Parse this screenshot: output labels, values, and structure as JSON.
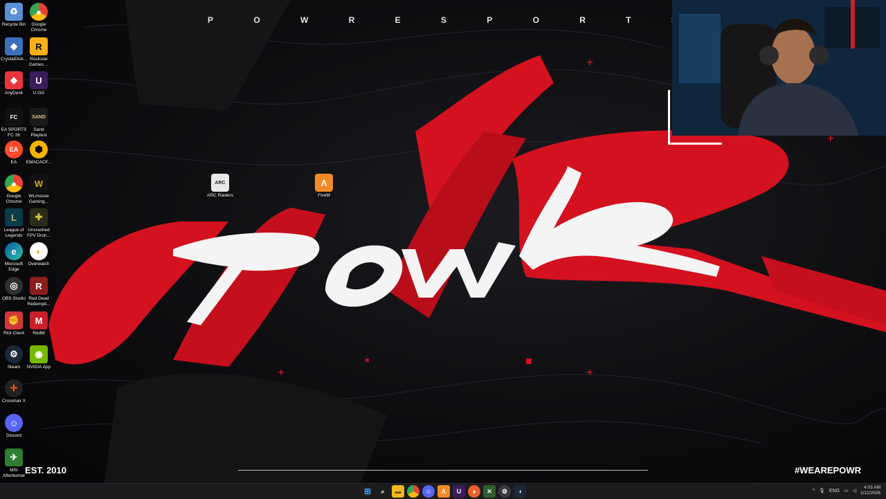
{
  "wallpaper": {
    "wordmark_letters": [
      "P",
      "O",
      "W",
      "R",
      "E",
      "S",
      "P",
      "O",
      "R",
      "T",
      "S"
    ],
    "est": "EST. 2010",
    "hashtag": "#WEAREPOWR",
    "logo_text": "POWR",
    "colors": {
      "red": "#d4111f",
      "white": "#f4f4f4",
      "dark": "#0b0b0d"
    }
  },
  "desktop_icons": [
    {
      "label": "Recycle Bin",
      "icon": "recycle-bin-icon"
    },
    {
      "label": "Google Chrome",
      "icon": "chrome-icon"
    },
    {
      "label": "CrystalDisk...",
      "icon": "crystaldisk-icon"
    },
    {
      "label": "Rockstar Games ...",
      "icon": "rockstar-icon"
    },
    {
      "label": "AnyDesk",
      "icon": "anydesk-icon"
    },
    {
      "label": "U.GG",
      "icon": "ugg-icon"
    },
    {
      "label": "EA SPORTS FC 26",
      "icon": "ea-fc-icon"
    },
    {
      "label": "Sand Playtest",
      "icon": "sand-icon"
    },
    {
      "label": "EA",
      "icon": "ea-icon"
    },
    {
      "label": "EMACACF...",
      "icon": "emacacf-icon"
    },
    {
      "label": "Google Chrome",
      "icon": "chrome-icon"
    },
    {
      "label": "WLmouse Gaming...",
      "icon": "wlmouse-icon"
    },
    {
      "label": "League of Legends",
      "icon": "league-icon"
    },
    {
      "label": "Uncrashed FPV Dron...",
      "icon": "uncrashed-icon"
    },
    {
      "label": "Microsoft Edge",
      "icon": "edge-icon"
    },
    {
      "label": "Overwatch",
      "icon": "overwatch-icon"
    },
    {
      "label": "OBS Studio",
      "icon": "obs-icon"
    },
    {
      "label": "Red Dead Redempti...",
      "icon": "rdr-icon"
    },
    {
      "label": "Riot Client",
      "icon": "riot-icon"
    },
    {
      "label": "RedM",
      "icon": "redm-icon"
    },
    {
      "label": "Steam",
      "icon": "steam-icon"
    },
    {
      "label": "NVIDIA App",
      "icon": "nvidia-icon"
    },
    {
      "label": "Crosshair X",
      "icon": "crosshair-icon"
    },
    {
      "label": "Discord",
      "icon": "discord-icon"
    },
    {
      "label": "MSI Afterburner",
      "icon": "msi-icon"
    },
    {
      "label": "ARC Raiders",
      "icon": "arc-raiders-icon"
    },
    {
      "label": "FiveM",
      "icon": "fivem-icon"
    }
  ],
  "taskbar": {
    "pinned": [
      "windows-start-icon",
      "search-icon",
      "file-explorer-icon",
      "chrome-icon",
      "discord-icon",
      "fivem-icon",
      "ugg-icon",
      "firefox-icon",
      "xbox-icon",
      "settings-icon",
      "steam-icon"
    ],
    "language": "ENG",
    "time": "4:03 AM",
    "date": "1/12/2026"
  }
}
